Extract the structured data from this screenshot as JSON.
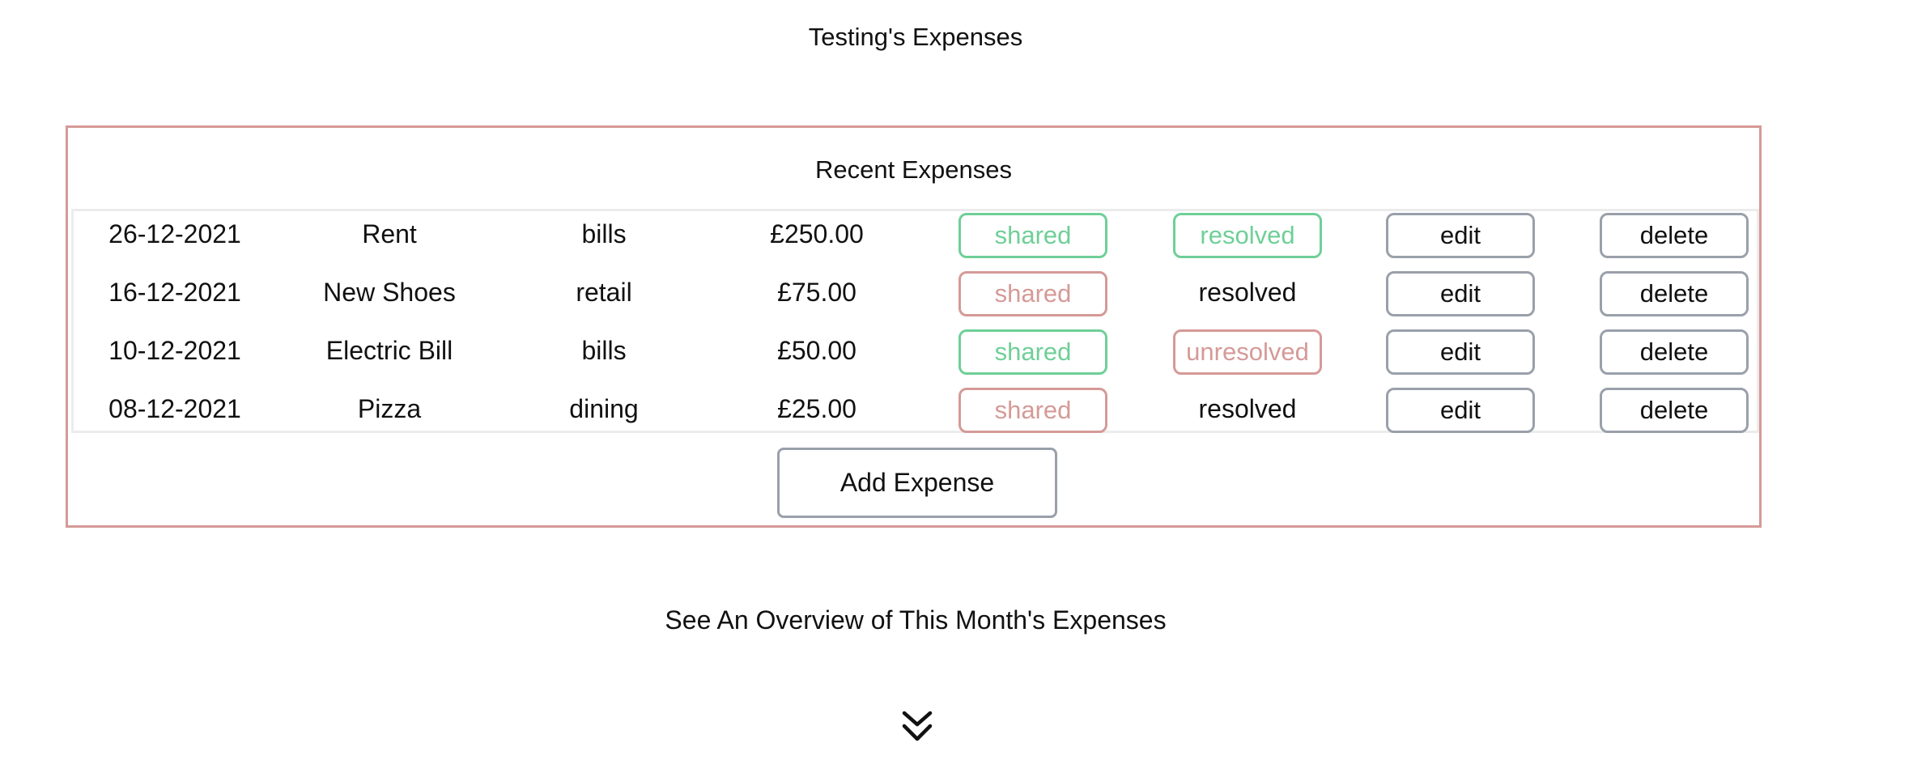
{
  "page_title": "Testing's Expenses",
  "recent": {
    "title": "Recent Expenses",
    "rows": [
      {
        "date": "26-12-2021",
        "name": "Rent",
        "category": "bills",
        "amount": "£250.00",
        "shared": "shared",
        "shared_state": "green",
        "status": "resolved",
        "status_style": "green",
        "edit": "edit",
        "delete": "delete"
      },
      {
        "date": "16-12-2021",
        "name": "New Shoes",
        "category": "retail",
        "amount": "£75.00",
        "shared": "shared",
        "shared_state": "red",
        "status": "resolved",
        "status_style": "plain",
        "edit": "edit",
        "delete": "delete"
      },
      {
        "date": "10-12-2021",
        "name": "Electric Bill",
        "category": "bills",
        "amount": "£50.00",
        "shared": "shared",
        "shared_state": "green",
        "status": "unresolved",
        "status_style": "red",
        "edit": "edit",
        "delete": "delete"
      },
      {
        "date": "08-12-2021",
        "name": "Pizza",
        "category": "dining",
        "amount": "£25.00",
        "shared": "shared",
        "shared_state": "red",
        "status": "resolved",
        "status_style": "plain",
        "edit": "edit",
        "delete": "delete"
      }
    ],
    "add_label": "Add Expense"
  },
  "overview": {
    "text": "See An Overview of This Month's Expenses",
    "icon": "double-chevron-down-icon"
  },
  "colors": {
    "accent_red": "#d59a97",
    "accent_green": "#6fcf97",
    "button_border": "#9aa0aa"
  }
}
